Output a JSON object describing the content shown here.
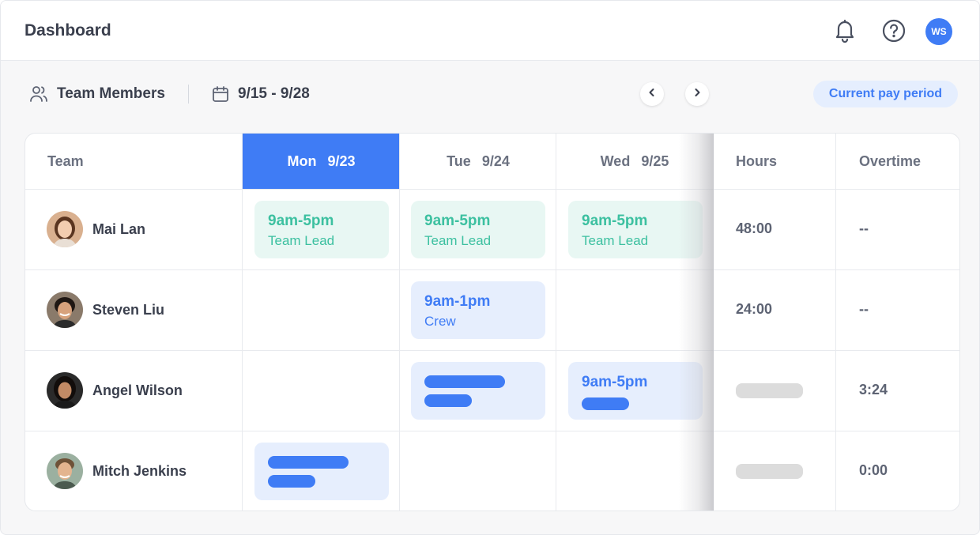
{
  "header": {
    "title": "Dashboard",
    "avatar_initials": "WS"
  },
  "toolbar": {
    "team_members_label": "Team Members",
    "date_range": "9/15 - 9/28",
    "pay_period_label": "Current pay period"
  },
  "table": {
    "columns": {
      "team": "Team",
      "mon": {
        "day": "Mon",
        "date": "9/23"
      },
      "tue": {
        "day": "Tue",
        "date": "9/24"
      },
      "wed": {
        "day": "Wed",
        "date": "9/25"
      },
      "hours": "Hours",
      "overtime": "Overtime"
    },
    "rows": [
      {
        "name": "Mai Lan",
        "mon": {
          "time": "9am-5pm",
          "role": "Team Lead"
        },
        "tue": {
          "time": "9am-5pm",
          "role": "Team Lead"
        },
        "wed": {
          "time": "9am-5pm",
          "role": "Team Lead"
        },
        "hours": "48:00",
        "overtime": "--"
      },
      {
        "name": "Steven Liu",
        "tue": {
          "time": "9am-1pm",
          "role": "Crew"
        },
        "hours": "24:00",
        "overtime": "--"
      },
      {
        "name": "Angel Wilson",
        "wed": {
          "time": "9am-5pm"
        },
        "overtime": "3:24"
      },
      {
        "name": "Mitch Jenkins",
        "overtime": "0:00"
      }
    ]
  },
  "colors": {
    "accent": "#3f7cf5",
    "shift_green": "#3cc0a0",
    "shift_green_bg": "#e8f7f3",
    "shift_blue_bg": "#e6eefd",
    "placeholder_gray": "#dcdcdc"
  },
  "icons": [
    "bell-icon",
    "help-icon",
    "team-members-icon",
    "calendar-icon",
    "chevron-left-icon",
    "chevron-right-icon"
  ]
}
